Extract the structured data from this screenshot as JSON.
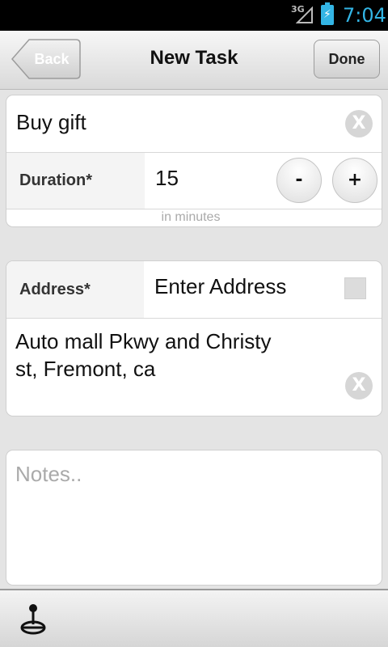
{
  "status_bar": {
    "network": "3G",
    "time": "7:04"
  },
  "header": {
    "back_label": "Back",
    "title": "New Task",
    "done_label": "Done"
  },
  "task": {
    "name": "Buy gift",
    "duration_label": "Duration*",
    "duration_value": "15",
    "minus_label": "-",
    "plus_label": "+",
    "duration_hint": "in minutes",
    "clear_glyph": "X"
  },
  "address": {
    "label": "Address*",
    "input_placeholder": "Enter Address",
    "value_line1": "Auto mall Pkwy and Christy",
    "value_line2": "st, Fremont, ca",
    "clear_glyph": "X"
  },
  "notes": {
    "placeholder": "Notes.."
  },
  "colors": {
    "accent": "#33b5e5",
    "status_bar": "#000000",
    "page_bg": "#e4e4e4"
  },
  "icons": [
    "signal-icon",
    "battery-icon",
    "clear-icon",
    "joystick-icon"
  ]
}
